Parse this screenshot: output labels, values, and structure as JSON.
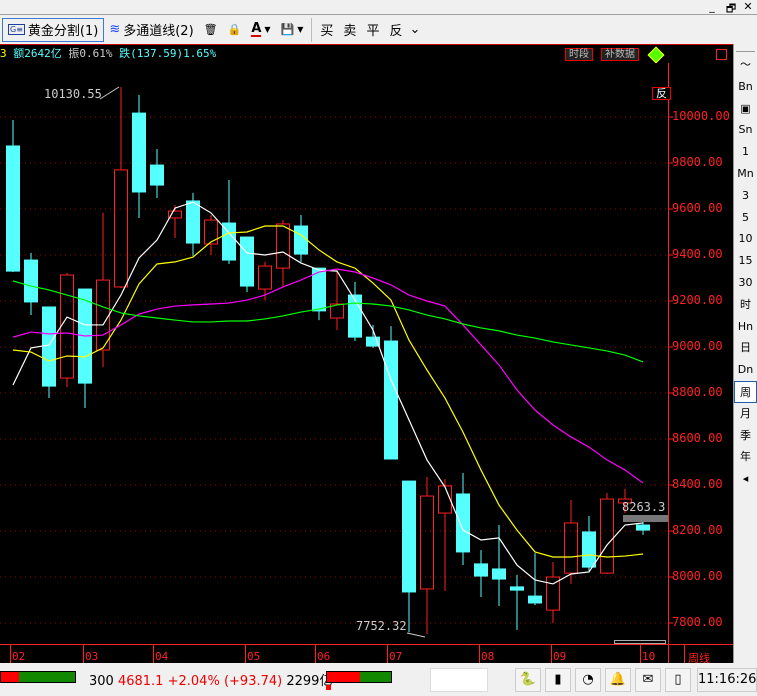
{
  "window": {
    "minimize": "_",
    "restore": "🗗",
    "close": "✕"
  },
  "toolbar": {
    "golden_split": "黄金分割(1)",
    "golden_icon_text": "G≡",
    "multi_channel": "多通道线(2)",
    "delete": "🗑",
    "lock": "🔒",
    "text_color": "A",
    "save": "💾",
    "buy": "买",
    "sell": "卖",
    "flat": "平",
    "reverse": "反",
    "more": "⌄"
  },
  "infobar": {
    "prefix": "3",
    "amount": "额2642亿",
    "amplitude": "振0.61%",
    "change": "跌(137.59)1.65%"
  },
  "chart_tags": {
    "period": "时段",
    "fill_data": "补数据",
    "reverse": "反",
    "high_label": "10130.55",
    "low_label": "7752.32",
    "last_price": "8263.3"
  },
  "colors": {
    "up": "#ff2020",
    "down": "#55ffff",
    "ma5": "#ffffff",
    "ma10": "#ffff00",
    "ma20": "#ff00ff",
    "ma60": "#00ff00",
    "axis": "#ff2020",
    "grid": "#a00000"
  },
  "price_axis": [
    "10000.00",
    "9800.00",
    "9600.00",
    "9400.00",
    "9200.00",
    "9000.00",
    "8800.00",
    "8600.00",
    "8400.00",
    "8200.00",
    "8000.00",
    "7800.00"
  ],
  "date_axis": [
    "02",
    "03",
    "04",
    "05",
    "06",
    "07",
    "08",
    "09",
    "10"
  ],
  "period_label": "周线",
  "candles": [
    [
      9874,
      9987,
      9326,
      9330
    ],
    [
      9378,
      9409,
      9139,
      9196
    ],
    [
      9174,
      9174,
      8778,
      8830
    ],
    [
      8865,
      9322,
      8826,
      9313
    ],
    [
      9252,
      9252,
      8735,
      8843
    ],
    [
      8987,
      9583,
      8913,
      9291
    ],
    [
      9261,
      10130.55,
      9256,
      9770
    ],
    [
      10017,
      10096,
      9561,
      9674
    ],
    [
      9791,
      9861,
      9648,
      9704
    ],
    [
      9561,
      9617,
      9474,
      9591
    ],
    [
      9635,
      9670,
      9396,
      9452
    ],
    [
      9448,
      9574,
      9400,
      9552
    ],
    [
      9539,
      9726,
      9361,
      9378
    ],
    [
      9478,
      9478,
      9239,
      9265
    ],
    [
      9252,
      9370,
      9204,
      9352
    ],
    [
      9343,
      9552,
      9261,
      9535
    ],
    [
      9526,
      9574,
      9370,
      9404
    ],
    [
      9343,
      9343,
      9117,
      9157
    ],
    [
      9126,
      9335,
      9074,
      9187
    ],
    [
      9226,
      9283,
      9026,
      9043
    ],
    [
      9043,
      9096,
      8996,
      9004
    ],
    [
      9026,
      9091,
      8513,
      8513
    ],
    [
      8417,
      8417,
      7760,
      7935
    ],
    [
      7948,
      8435,
      7752.32,
      8352
    ],
    [
      8278,
      8426,
      7939,
      8396
    ],
    [
      8361,
      8452,
      8052,
      8109
    ],
    [
      8057,
      8117,
      7913,
      8004
    ],
    [
      8035,
      8226,
      7874,
      7991
    ],
    [
      7957,
      8009,
      7770,
      7943
    ],
    [
      7917,
      8104,
      7878,
      7887
    ],
    [
      7856,
      8065,
      7800,
      8000
    ],
    [
      8017,
      8335,
      7970,
      8235
    ],
    [
      8196,
      8265,
      8026,
      8043
    ],
    [
      8017,
      8365,
      8013,
      8339
    ],
    [
      8322,
      8383,
      8278,
      8339
    ],
    [
      8226,
      8239,
      8183,
      8204
    ]
  ],
  "ma": {
    "ma5": [
      8835,
      8996,
      9009,
      9130,
      9096,
      9096,
      9226,
      9387,
      9465,
      9604,
      9630,
      9583,
      9496,
      9409,
      9400,
      9413,
      9365,
      9335,
      9330,
      9204,
      9074,
      8857,
      8683,
      8509,
      8391,
      8204,
      8161,
      8170,
      8052,
      7987,
      7970,
      8013,
      8022,
      8139,
      8226,
      8235
    ],
    "ma10": [
      8987,
      8978,
      8939,
      8961,
      8957,
      8996,
      9117,
      9274,
      9361,
      9370,
      9391,
      9457,
      9496,
      9500,
      9526,
      9526,
      9487,
      9422,
      9370,
      9343,
      9278,
      9204,
      9030,
      8900,
      8778,
      8630,
      8465,
      8313,
      8204,
      8109,
      8087,
      8087,
      8096,
      8087,
      8091,
      8100
    ],
    "ma20": [
      9043,
      9065,
      9057,
      9061,
      9048,
      9052,
      9096,
      9143,
      9165,
      9178,
      9183,
      9187,
      9191,
      9204,
      9226,
      9261,
      9291,
      9326,
      9339,
      9326,
      9300,
      9270,
      9226,
      9200,
      9178,
      9096,
      9009,
      8922,
      8813,
      8726,
      8661,
      8609,
      8565,
      8509,
      8465,
      8409
    ],
    "ma60": [
      9287,
      9265,
      9248,
      9226,
      9204,
      9174,
      9148,
      9135,
      9126,
      9117,
      9109,
      9109,
      9113,
      9113,
      9122,
      9135,
      9152,
      9165,
      9183,
      9191,
      9187,
      9178,
      9161,
      9139,
      9122,
      9100,
      9083,
      9070,
      9052,
      9039,
      9022,
      9009,
      8996,
      8983,
      8965,
      8935
    ]
  },
  "sidebar": [
    "〜",
    "Bn",
    "▣",
    "Sn",
    "1",
    "Mn",
    "3",
    "5",
    "10",
    "15",
    "30",
    "时",
    "Hn",
    "日",
    "Dn",
    "周",
    "月",
    "季",
    "年",
    "◂"
  ],
  "sidebar_active": 15,
  "status": {
    "index_code": "300",
    "index_value": "4681.1",
    "index_change": "+2.04%",
    "index_delta": "(+93.74)",
    "index_turnover": "2299亿",
    "time": "11:16:26",
    "icons": [
      "python",
      "database",
      "network",
      "bell",
      "mail",
      "device"
    ],
    "icon_glyphs": [
      "🐍",
      "▮",
      "◔",
      "🔔",
      "✉",
      "▯"
    ]
  }
}
